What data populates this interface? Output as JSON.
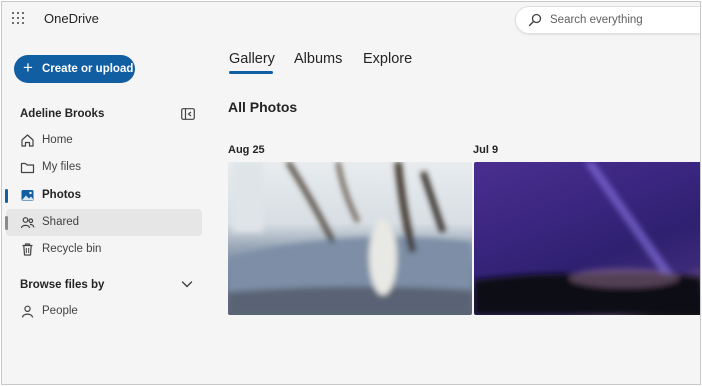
{
  "header": {
    "app_name": "OneDrive",
    "search_placeholder": "Search everything"
  },
  "sidebar": {
    "create_button_label": "Create or upload",
    "user_name": "Adeline Brooks",
    "items": [
      {
        "label": "Home",
        "icon": "home-icon"
      },
      {
        "label": "My files",
        "icon": "folder-icon"
      },
      {
        "label": "Photos",
        "icon": "photos-icon",
        "selected": true
      },
      {
        "label": "Shared",
        "icon": "shared-icon"
      },
      {
        "label": "Recycle bin",
        "icon": "recycle-bin-icon"
      }
    ],
    "browse_section": {
      "title": "Browse files by",
      "items": [
        {
          "label": "People",
          "icon": "person-icon"
        }
      ]
    }
  },
  "main": {
    "tabs": [
      {
        "label": "Gallery",
        "selected": true
      },
      {
        "label": "Albums"
      },
      {
        "label": "Explore"
      }
    ],
    "section_title": "All Photos",
    "photo_groups": [
      {
        "date": "Aug 25"
      },
      {
        "date": "Jul 9"
      }
    ]
  },
  "colors": {
    "accent": "#115ea3",
    "background": "#f5f5f5"
  }
}
